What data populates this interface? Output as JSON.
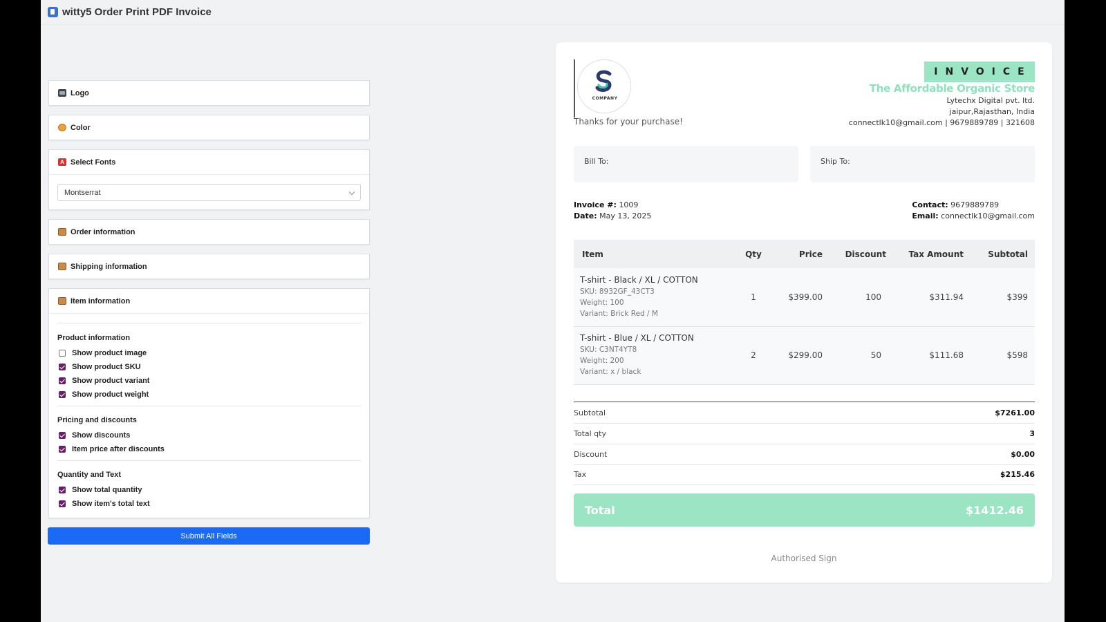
{
  "app": {
    "title": "witty5 Order Print PDF Invoice",
    "icon": "pdf-doc-icon"
  },
  "settings": {
    "logo_label": "Logo",
    "color_label": "Color",
    "fonts_label": "Select Fonts",
    "font_selected": "Montserrat",
    "order_label": "Order information",
    "shipping_label": "Shipping information",
    "item_label": "Item information",
    "groups": {
      "product_title": "Product information",
      "product_image": "Show product image",
      "product_sku": "Show product SKU",
      "product_variant": "Show product variant",
      "product_weight": "Show product weight",
      "pricing_title": "Pricing and discounts",
      "show_discounts": "Show discounts",
      "price_after": "Item price after discounts",
      "qty_title": "Quantity and Text",
      "total_qty": "Show total quantity",
      "total_text": "Show item's total text"
    },
    "submit_label": "Submit All Fields"
  },
  "invoice": {
    "badge": "INVOICE",
    "store_name": "The Affordable Organic Store",
    "company": "Lytechx Digital pvt. ltd.",
    "location": "jaipur,Rajasthan, India",
    "contact_line": "connectlk10@gmail.com | 9679889789 | 321608",
    "logo_text": "COMPANY",
    "thanks": "Thanks for your purchase!",
    "bill_to": "Bill To:",
    "ship_to": "Ship To:",
    "invoice_no_label": "Invoice #:",
    "invoice_no": "1009",
    "date_label": "Date:",
    "date": "May 13, 2025",
    "contact_label": "Contact:",
    "contact": "9679889789",
    "email_label": "Email:",
    "email": "connectlk10@gmail.com",
    "columns": [
      "Item",
      "Qty",
      "Price",
      "Discount",
      "Tax Amount",
      "Subtotal"
    ],
    "items": [
      {
        "name": "T-shirt - Black / XL / COTTON",
        "sku": "SKU: 8932GF_43CT3",
        "weight": "Weight: 100",
        "variant": "Variant: Brick Red / M",
        "qty": "1",
        "price": "$399.00",
        "discount": "100",
        "tax": "$311.94",
        "subtotal": "$399"
      },
      {
        "name": "T-shirt - Blue / XL / COTTON",
        "sku": "SKU: C3NT4YT8",
        "weight": "Weight: 200",
        "variant": "Variant: x / black",
        "qty": "2",
        "price": "$299.00",
        "discount": "50",
        "tax": "$111.68",
        "subtotal": "$598"
      }
    ],
    "summary": {
      "subtotal_label": "Subtotal",
      "subtotal": "$7261.00",
      "qty_label": "Total qty",
      "qty": "3",
      "discount_label": "Discount",
      "discount": "$0.00",
      "tax_label": "Tax",
      "tax": "$215.46"
    },
    "total_label": "Total",
    "total": "$1412.46",
    "sign": "Authorised Sign",
    "accent_color": "#9be5c4"
  }
}
